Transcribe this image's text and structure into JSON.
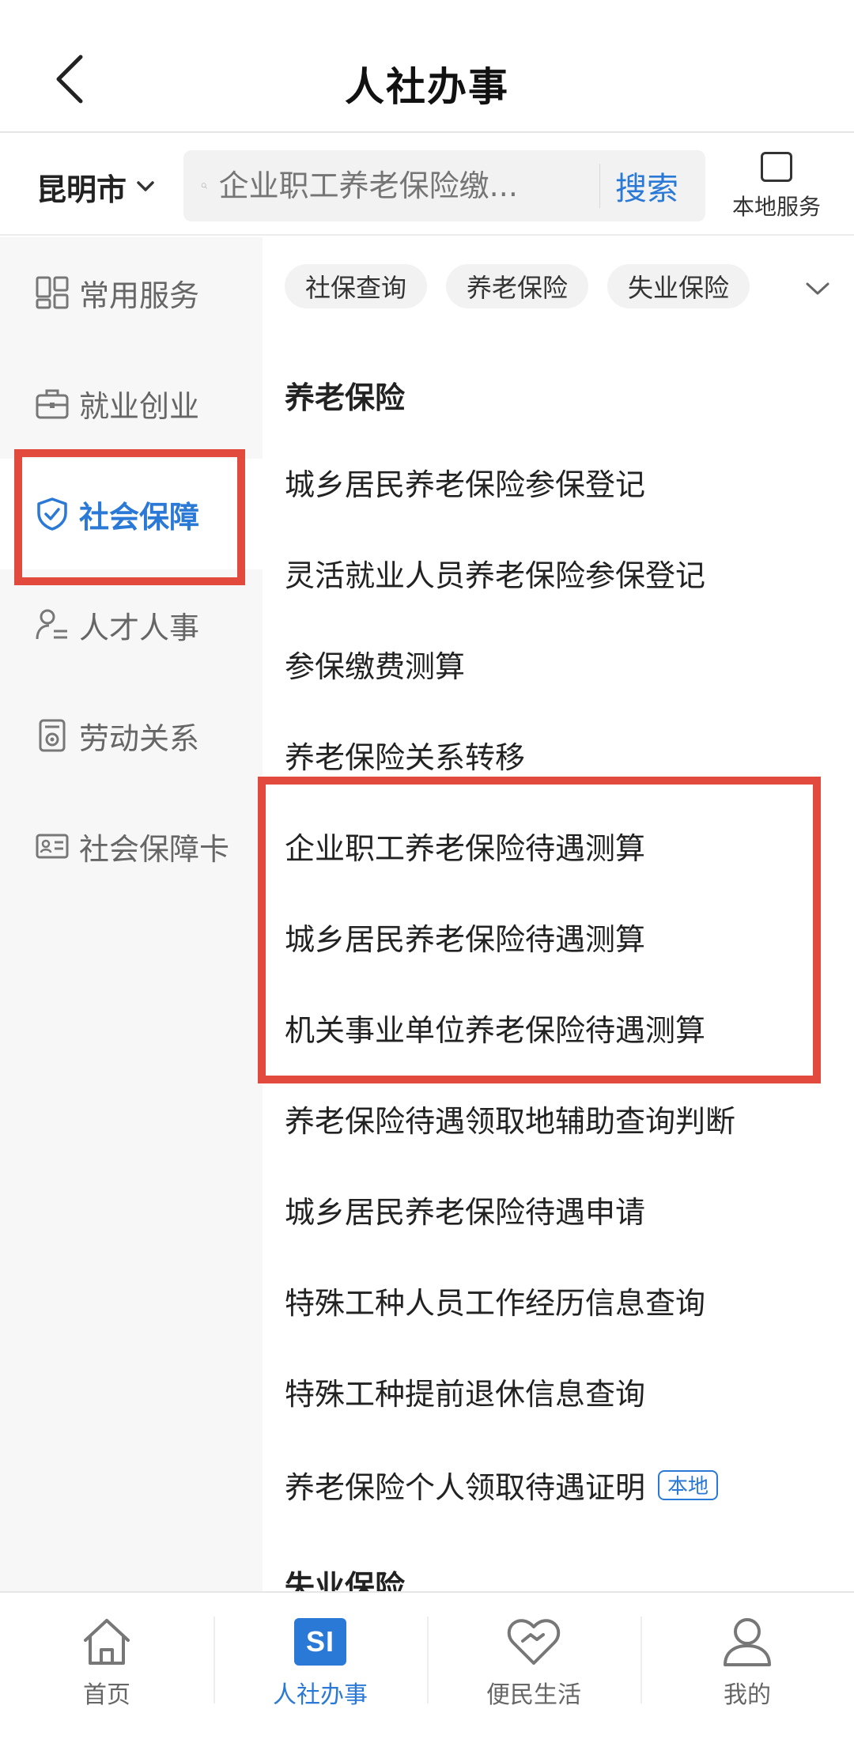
{
  "header": {
    "title": "人社办事"
  },
  "search": {
    "city": "昆明市",
    "placeholder": "企业职工养老保险缴...",
    "button": "搜索",
    "local_service": "本地服务"
  },
  "sidebar": {
    "items": [
      {
        "label": "常用服务",
        "icon": "grid-icon"
      },
      {
        "label": "就业创业",
        "icon": "briefcase-icon"
      },
      {
        "label": "社会保障",
        "icon": "shield-check-icon",
        "active": true
      },
      {
        "label": "人才人事",
        "icon": "person-list-icon"
      },
      {
        "label": "劳动关系",
        "icon": "document-badge-icon"
      },
      {
        "label": "社会保障卡",
        "icon": "id-card-icon"
      }
    ]
  },
  "chips": [
    "社保查询",
    "养老保险",
    "失业保险"
  ],
  "sections": [
    {
      "title": "养老保险",
      "items": [
        "城乡居民养老保险参保登记",
        "灵活就业人员养老保险参保登记",
        "参保缴费测算",
        "养老保险关系转移",
        "企业职工养老保险待遇测算",
        "城乡居民养老保险待遇测算",
        "机关事业单位养老保险待遇测算",
        "养老保险待遇领取地辅助查询判断",
        "城乡居民养老保险待遇申请",
        "特殊工种人员工作经历信息查询",
        "特殊工种提前退休信息查询",
        "养老保险个人领取待遇证明"
      ],
      "badge": "本地"
    },
    {
      "title": "失业保险"
    }
  ],
  "tabbar": {
    "tabs": [
      {
        "label": "首页",
        "icon": "home-icon"
      },
      {
        "label": "人社办事",
        "icon": "si-logo-icon",
        "logo_text": "SI",
        "active": true
      },
      {
        "label": "便民生活",
        "icon": "heart-handshake-icon"
      },
      {
        "label": "我的",
        "icon": "user-icon"
      }
    ]
  },
  "colors": {
    "accent": "#2a79d6",
    "highlight": "#e34a3e"
  }
}
